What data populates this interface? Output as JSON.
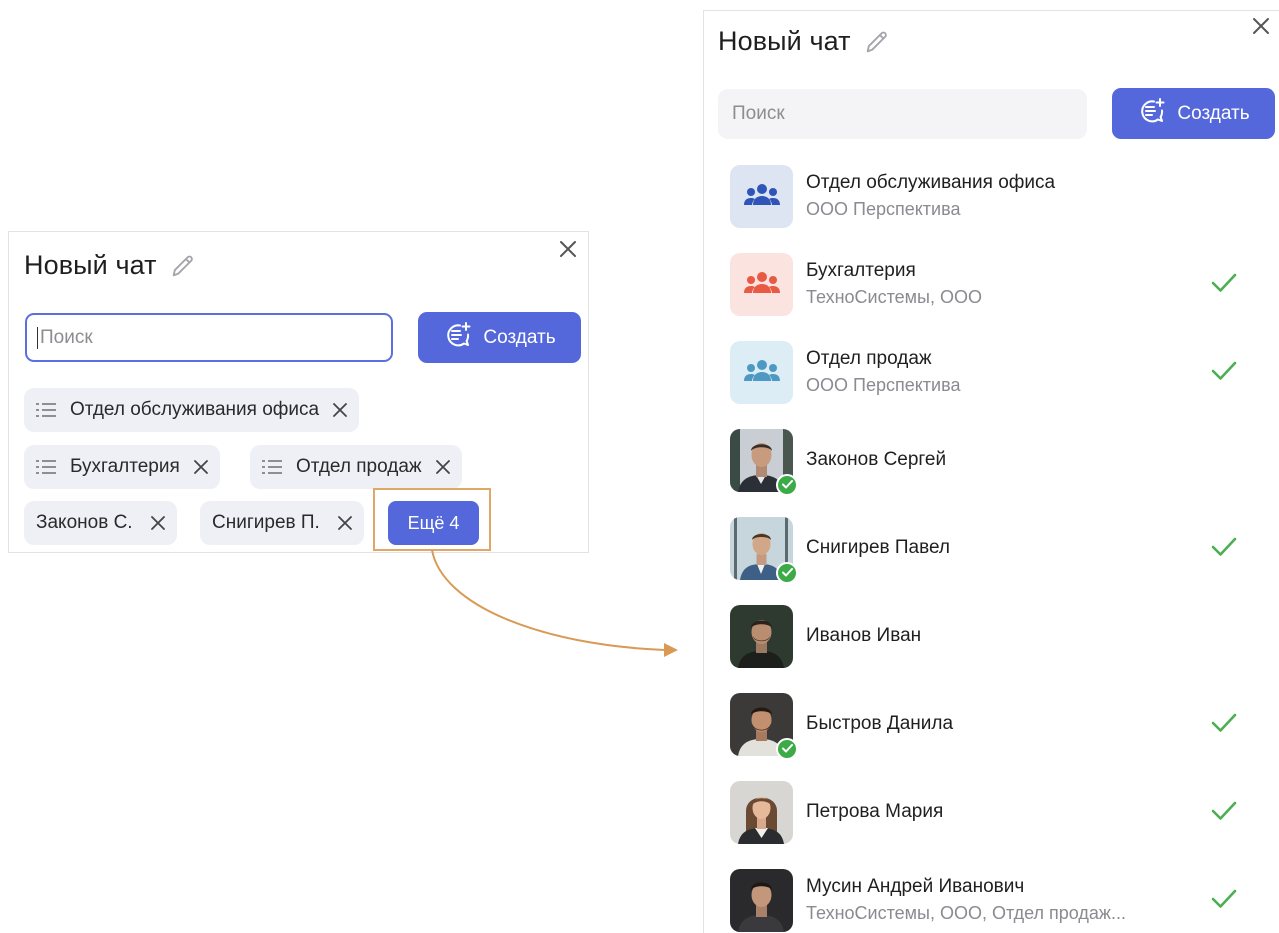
{
  "left_panel": {
    "title": "Новый чат",
    "search_placeholder": "Поиск",
    "create_label": "Создать",
    "chips": [
      {
        "label": "Отдел обслуживания офиса",
        "type": "group"
      },
      {
        "label": "Бухгалтерия",
        "type": "group"
      },
      {
        "label": "Отдел продаж",
        "type": "group"
      },
      {
        "label": "Законов С.",
        "type": "person"
      },
      {
        "label": "Снигирев П.",
        "type": "person"
      }
    ],
    "more_label": "Ещё 4"
  },
  "right_panel": {
    "title": "Новый чат",
    "search_placeholder": "Поиск",
    "create_label": "Создать",
    "items": [
      {
        "name": "Отдел обслуживания офиса",
        "subtitle": "ООО Перспектива",
        "avatar": "group-icon",
        "avatar_bg": "#dde5f2",
        "avatar_color": "#2f55b8",
        "selected": false,
        "online": false
      },
      {
        "name": "Бухгалтерия",
        "subtitle": "ТехноСистемы, ООО",
        "avatar": "group-icon",
        "avatar_bg": "#fbe3df",
        "avatar_color": "#e85a43",
        "selected": true,
        "online": false
      },
      {
        "name": "Отдел продаж",
        "subtitle": "ООО Перспектива",
        "avatar": "group-icon",
        "avatar_bg": "#dcedf5",
        "avatar_color": "#4d99c4",
        "selected": true,
        "online": false
      },
      {
        "name": "Законов Сергей",
        "subtitle": "",
        "avatar": "person-photo",
        "selected": false,
        "online": true
      },
      {
        "name": "Снигирев Павел",
        "subtitle": "",
        "avatar": "person-photo",
        "selected": true,
        "online": true
      },
      {
        "name": "Иванов Иван",
        "subtitle": "",
        "avatar": "person-photo",
        "selected": false,
        "online": false
      },
      {
        "name": "Быстров Данила",
        "subtitle": "",
        "avatar": "person-photo",
        "selected": true,
        "online": true
      },
      {
        "name": "Петрова Мария",
        "subtitle": "",
        "avatar": "person-photo",
        "selected": true,
        "online": false
      },
      {
        "name": "Мусин Андрей Иванович",
        "subtitle": "ТехноСистемы, ООО, Отдел продаж...",
        "avatar": "person-photo",
        "selected": true,
        "online": false
      }
    ]
  },
  "colors": {
    "accent": "#5468dc",
    "check": "#4caf50",
    "highlight": "#e0a866",
    "chip_bg": "#eef0f6"
  }
}
